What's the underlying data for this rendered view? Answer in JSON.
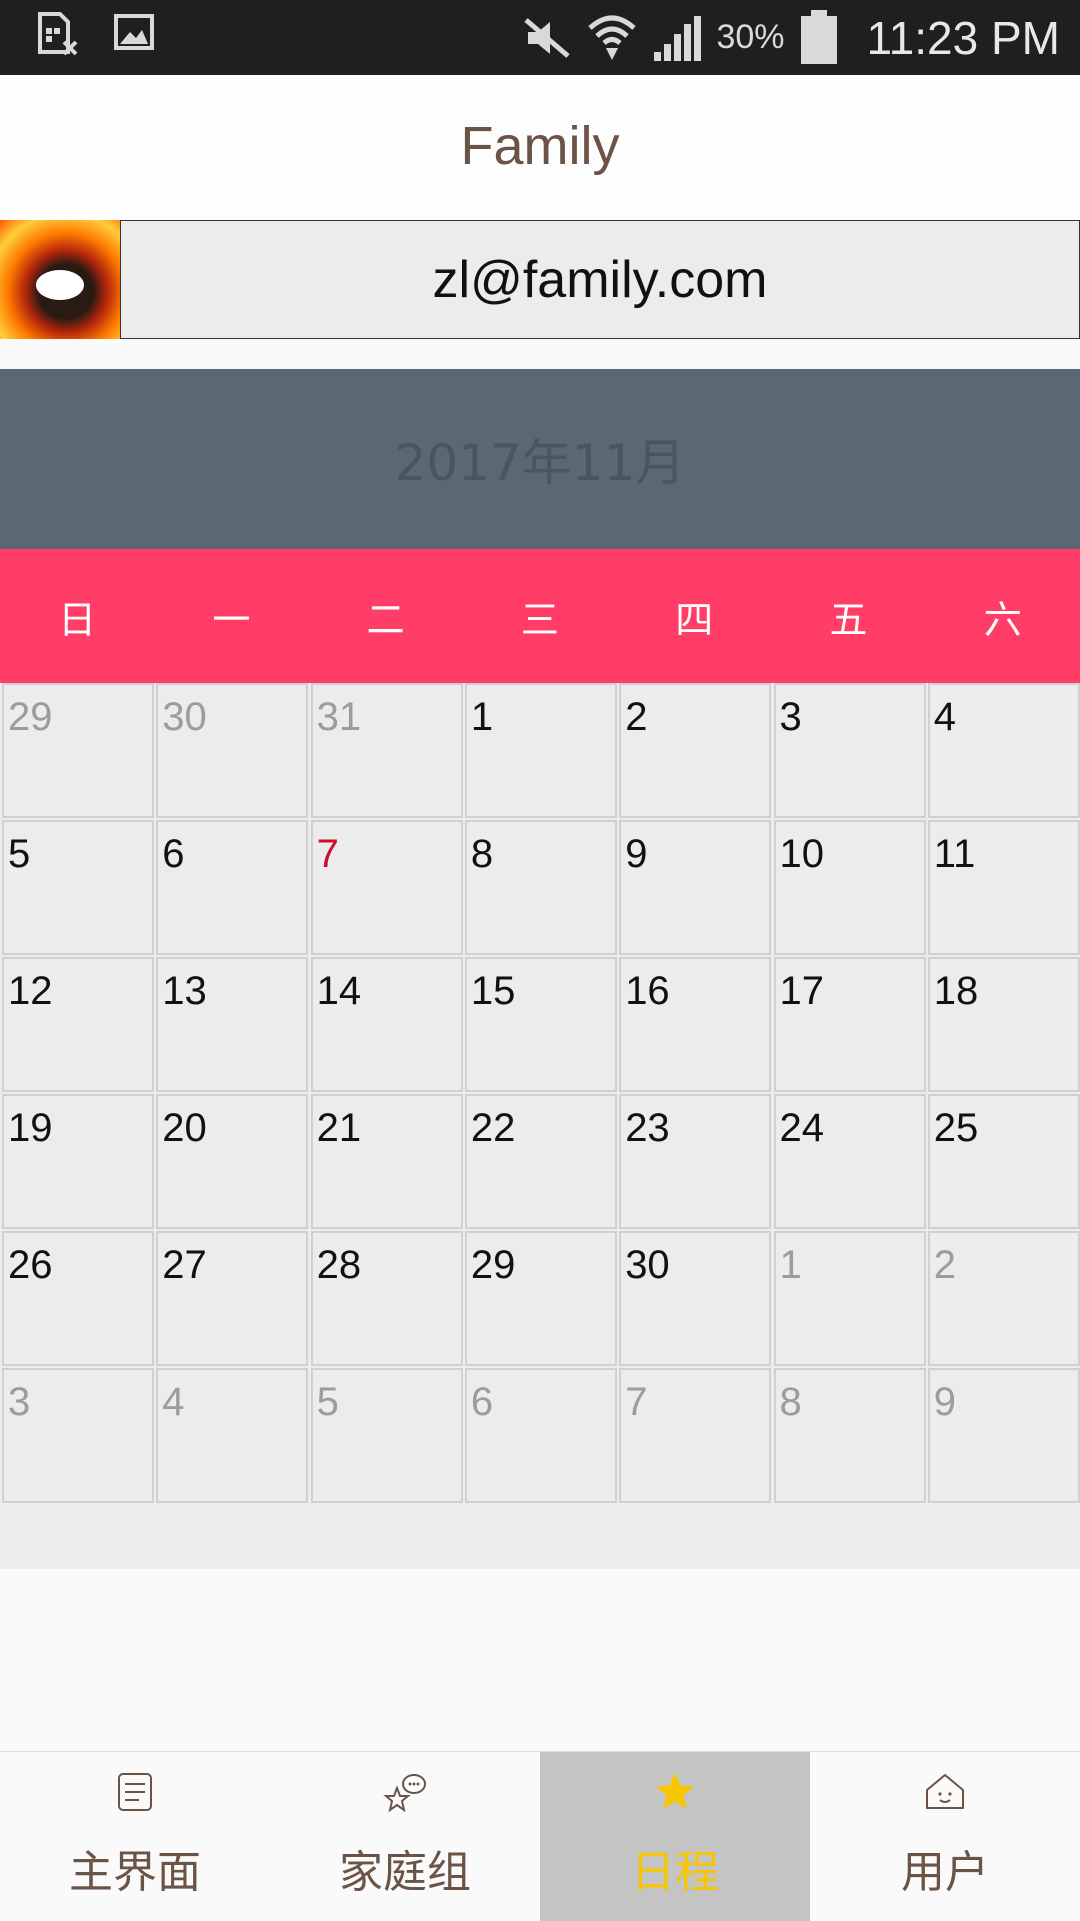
{
  "statusbar": {
    "battery_pct": "30%",
    "time": "11:23 PM",
    "icons": [
      "sim-off-icon",
      "image-icon",
      "mute-icon",
      "wifi-icon",
      "signal-icon",
      "battery-icon"
    ]
  },
  "app": {
    "title": "Family"
  },
  "user": {
    "email": "zl@family.com",
    "avatar": "fire-character-avatar"
  },
  "calendar": {
    "month_label": "2017年11月",
    "weekdays": [
      "日",
      "一",
      "二",
      "三",
      "四",
      "五",
      "六"
    ],
    "weeks": [
      [
        {
          "d": "29",
          "o": true
        },
        {
          "d": "30",
          "o": true
        },
        {
          "d": "31",
          "o": true
        },
        {
          "d": "1"
        },
        {
          "d": "2"
        },
        {
          "d": "3"
        },
        {
          "d": "4"
        }
      ],
      [
        {
          "d": "5"
        },
        {
          "d": "6"
        },
        {
          "d": "7",
          "today": true
        },
        {
          "d": "8"
        },
        {
          "d": "9"
        },
        {
          "d": "10"
        },
        {
          "d": "11"
        }
      ],
      [
        {
          "d": "12"
        },
        {
          "d": "13"
        },
        {
          "d": "14"
        },
        {
          "d": "15"
        },
        {
          "d": "16"
        },
        {
          "d": "17"
        },
        {
          "d": "18"
        }
      ],
      [
        {
          "d": "19"
        },
        {
          "d": "20"
        },
        {
          "d": "21"
        },
        {
          "d": "22"
        },
        {
          "d": "23"
        },
        {
          "d": "24"
        },
        {
          "d": "25"
        }
      ],
      [
        {
          "d": "26"
        },
        {
          "d": "27"
        },
        {
          "d": "28"
        },
        {
          "d": "29"
        },
        {
          "d": "30"
        },
        {
          "d": "1",
          "o": true
        },
        {
          "d": "2",
          "o": true
        }
      ],
      [
        {
          "d": "3",
          "o": true
        },
        {
          "d": "4",
          "o": true
        },
        {
          "d": "5",
          "o": true
        },
        {
          "d": "6",
          "o": true
        },
        {
          "d": "7",
          "o": true
        },
        {
          "d": "8",
          "o": true
        },
        {
          "d": "9",
          "o": true
        }
      ]
    ],
    "colors": {
      "header": "#5a6874",
      "weekday_bar": "#ff3d67",
      "today": "#c8102e"
    }
  },
  "nav": {
    "items": [
      {
        "label": "主界面",
        "icon": "list-icon",
        "active": false
      },
      {
        "label": "家庭组",
        "icon": "chat-star-icon",
        "active": false
      },
      {
        "label": "日程",
        "icon": "star-icon",
        "active": true
      },
      {
        "label": "用户",
        "icon": "home-icon",
        "active": false
      }
    ],
    "active_color": "#f7c600"
  }
}
